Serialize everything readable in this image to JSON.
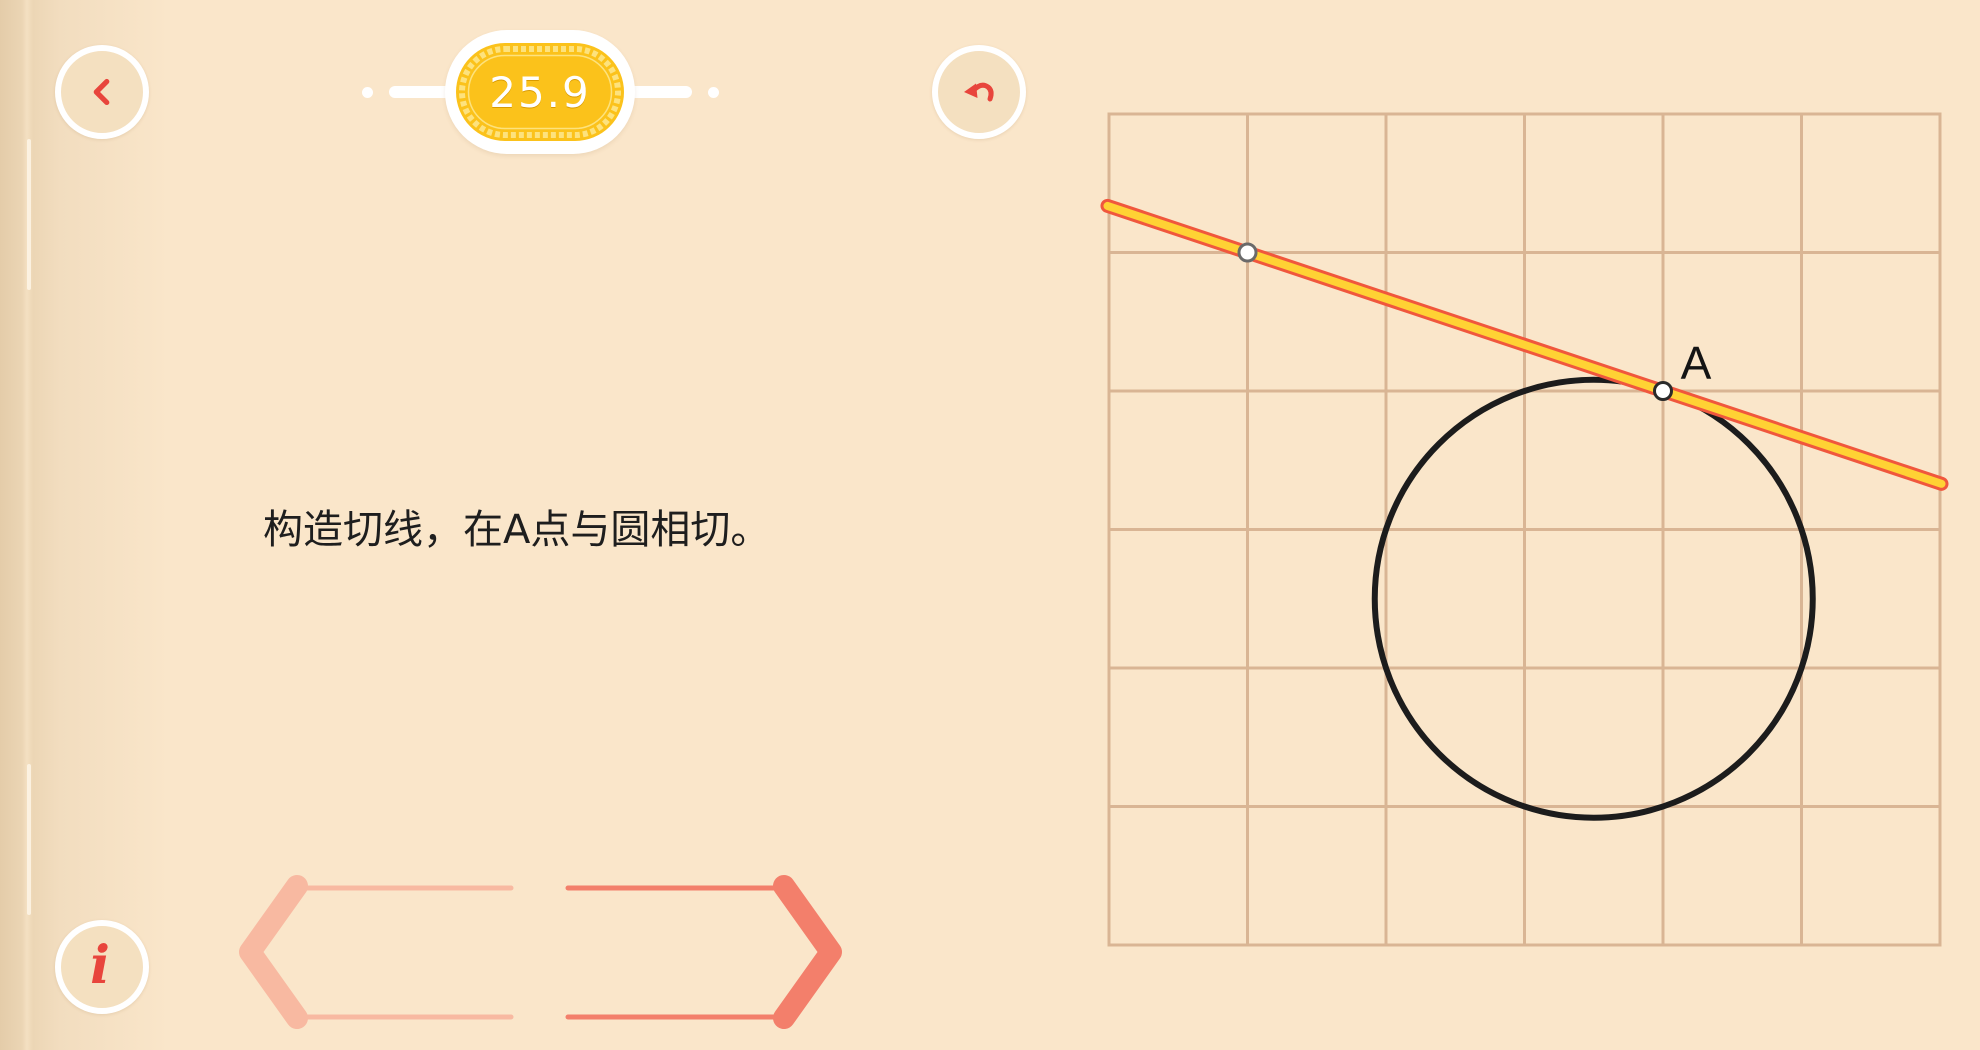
{
  "colors": {
    "page": "#fae6ca",
    "accent": "#e8453c",
    "button_ring": "#ffffff",
    "button_fill": "#f4e0c0",
    "badge_gold": "#fbc21b",
    "badge_pattern": "#fde27d",
    "grid": "#d9b594",
    "circle": "#1c1c1c",
    "tangent_fill": "#ffd234",
    "tangent_edge": "#f0573d",
    "nav_prev": "#f8b9a1",
    "nav_next": "#f37f6b"
  },
  "header": {
    "back_icon": "chevron-left-icon",
    "level": "25.9",
    "undo_icon": "undo-icon"
  },
  "task": {
    "instruction": "构造切线，在A点与圆相切。"
  },
  "board": {
    "point_label": "A"
  },
  "footer": {
    "info_icon": "info-icon",
    "info_glyph": "i",
    "prev_icon": "chevron-left-icon",
    "next_icon": "chevron-right-icon"
  }
}
